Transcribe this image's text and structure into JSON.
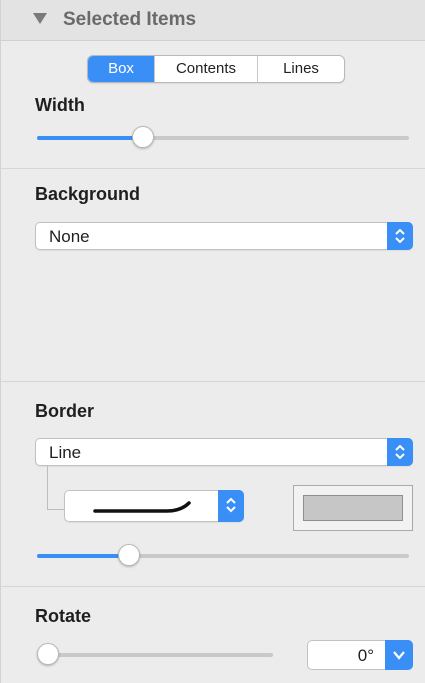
{
  "header": {
    "title": "Selected Items"
  },
  "tabs": [
    {
      "label": "Box",
      "active": true
    },
    {
      "label": "Contents",
      "active": false
    },
    {
      "label": "Lines",
      "active": false
    }
  ],
  "width": {
    "label": "Width",
    "slider_value": 0.27
  },
  "background": {
    "label": "Background",
    "selected": "None"
  },
  "border": {
    "label": "Border",
    "type_selected": "Line",
    "line_style_icon": "curved-line-icon",
    "color": "#c6c6c6",
    "slider_value": 0.23
  },
  "rotate": {
    "label": "Rotate",
    "slider_value": 0.0,
    "angle": "0°"
  },
  "accent_color": "#3a8ff7"
}
